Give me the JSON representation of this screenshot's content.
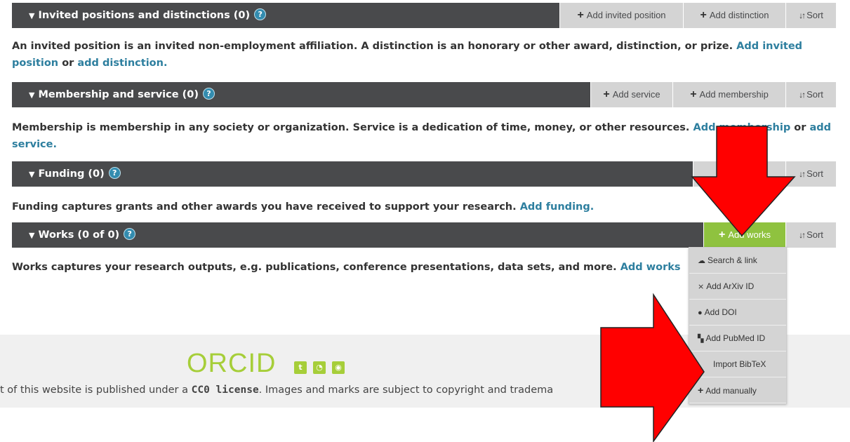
{
  "sections": [
    {
      "title": "Invited positions and distinctions (0)",
      "buttons": [
        "Add invited position",
        "Add distinction",
        "Sort"
      ],
      "description": "An invited position is an invited non-employment affiliation. A distinction is an honorary or other award, distinction, or prize.",
      "link1": "Add invited position",
      "conj": "or",
      "link2": "add distinction."
    },
    {
      "title": "Membership and service (0)",
      "buttons": [
        "Add service",
        "Add membership",
        "Sort"
      ],
      "description": "Membership is membership in any society or organization. Service is a dedication of time, money, or other resources.",
      "link1": "Add membership",
      "conj": "or",
      "link2": "add service."
    },
    {
      "title": "Funding (0)",
      "buttons": [
        "Sort"
      ],
      "description": "Funding captures grants and other awards you have received to support your research.",
      "link1": "Add funding."
    },
    {
      "title": "Works (0 of 0)",
      "buttons": [
        "Add works",
        "Sort"
      ],
      "description": "Works captures your research outputs, e.g. publications, conference presentations, data sets, and more.",
      "link1": "Add works"
    }
  ],
  "dropdown": [
    {
      "label": "Search & link",
      "icon": "cloud-upload-icon"
    },
    {
      "label": "Add ArXiv ID",
      "icon": "arxiv-icon"
    },
    {
      "label": "Add DOI",
      "icon": "doi-icon"
    },
    {
      "label": "Add PubMed ID",
      "icon": "pubmed-icon"
    },
    {
      "label": "Import BibTeX",
      "icon": "bibtex-icon"
    },
    {
      "label": "Add manually",
      "icon": "plus-icon"
    }
  ],
  "footer": {
    "logo": "ORCID",
    "text_before": "t of this website is published under a",
    "license": "CC0 license",
    "text_after": ". Images and marks are subject to copyright and tradema"
  },
  "colors": {
    "bar": "#494a4c",
    "button": "#d4d4d4",
    "accent_green": "#8fc23f",
    "link": "#2e7f9f",
    "arrow": "#ff0000"
  }
}
